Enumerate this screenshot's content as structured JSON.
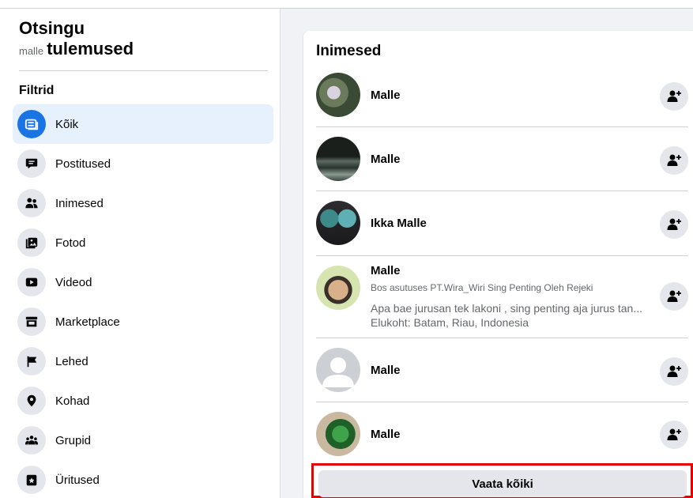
{
  "sidebar": {
    "title_line1": "Otsingu",
    "query": "malle",
    "title_line2": "tulemused",
    "filters_label": "Filtrid",
    "filters": [
      {
        "label": "Kõik",
        "icon": "feed-icon",
        "active": true
      },
      {
        "label": "Postitused",
        "icon": "posts-icon",
        "active": false
      },
      {
        "label": "Inimesed",
        "icon": "people-icon",
        "active": false
      },
      {
        "label": "Fotod",
        "icon": "photos-icon",
        "active": false
      },
      {
        "label": "Videod",
        "icon": "video-icon",
        "active": false
      },
      {
        "label": "Marketplace",
        "icon": "marketplace-icon",
        "active": false
      },
      {
        "label": "Lehed",
        "icon": "flag-icon",
        "active": false
      },
      {
        "label": "Kohad",
        "icon": "location-icon",
        "active": false
      },
      {
        "label": "Grupid",
        "icon": "groups-icon",
        "active": false
      },
      {
        "label": "Üritused",
        "icon": "events-icon",
        "active": false
      }
    ]
  },
  "main": {
    "section_title": "Inimesed",
    "people": [
      {
        "name": "Malle"
      },
      {
        "name": "Malle"
      },
      {
        "name": "Ikka Malle"
      },
      {
        "name": "Malle",
        "meta": "Bos asutuses PT.Wira_Wiri Sing Penting Oleh Rejeki",
        "desc": "Apa bae jurusan tek lakoni , sing penting aja jurus tan...",
        "location": "Elukoht: Batam, Riau, Indonesia"
      },
      {
        "name": "Malle"
      },
      {
        "name": "Malle"
      }
    ],
    "see_all_label": "Vaata kõiki"
  },
  "colors": {
    "accent": "#1b74e4",
    "active_bg": "#e7f0fd",
    "highlight_border": "#e60000"
  }
}
